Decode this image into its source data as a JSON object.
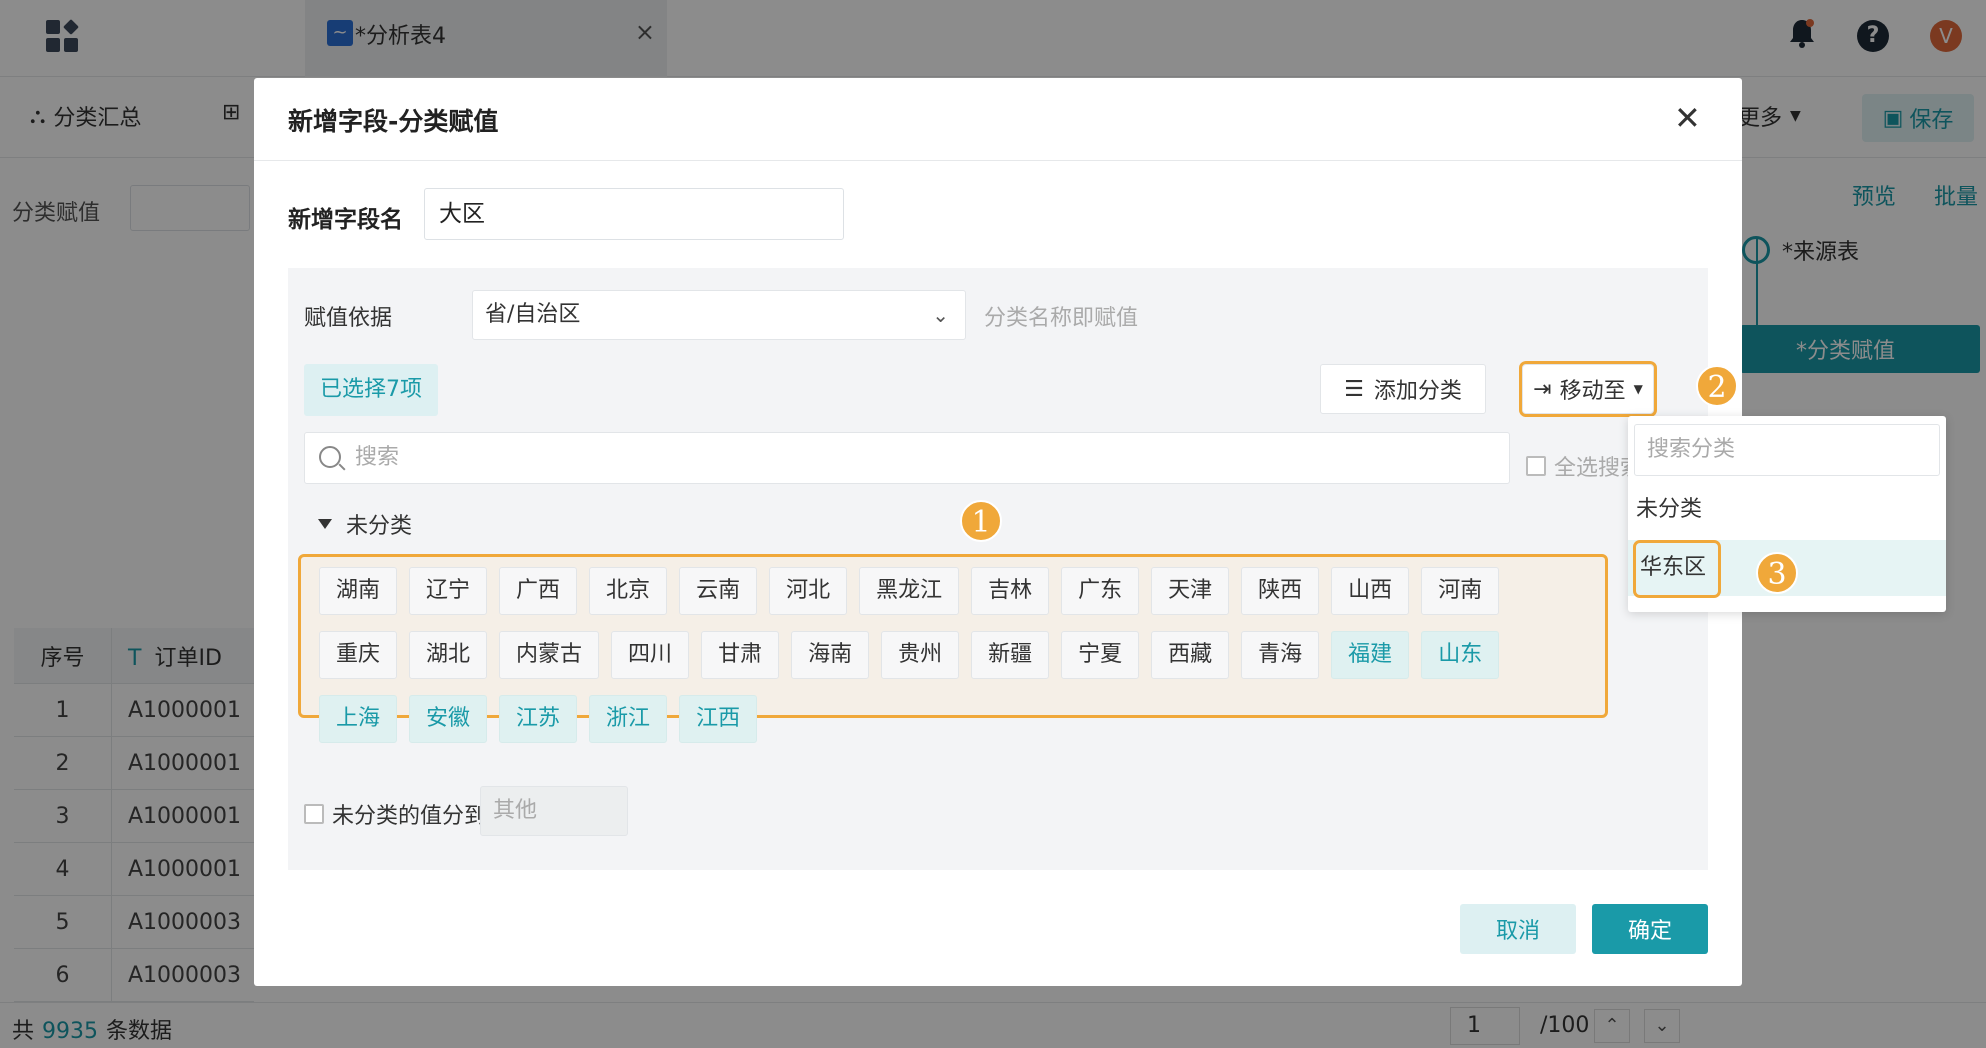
{
  "topbar": {
    "doc_tab_title": "*分析表4",
    "doc_tab_close": "×",
    "help_glyph": "?",
    "user_initial": "V"
  },
  "toolbar": {
    "summary_label": "分类汇总",
    "more_label": "更多",
    "save_label": "保存"
  },
  "left_panel": {
    "assign_label": "分类赋值"
  },
  "table": {
    "columns": [
      "序号",
      "订单ID"
    ],
    "column_type_glyph": "T",
    "rows": [
      [
        "1",
        "A1000001"
      ],
      [
        "2",
        "A1000001"
      ],
      [
        "3",
        "A1000001"
      ],
      [
        "4",
        "A1000001"
      ],
      [
        "5",
        "A1000003"
      ],
      [
        "6",
        "A1000003"
      ]
    ]
  },
  "footer": {
    "total_prefix": "共",
    "total_count": "9935",
    "total_suffix": "条数据",
    "page_value": "1",
    "page_total": "/100"
  },
  "right_panel": {
    "preview_link": "预览",
    "batch_link": "批量",
    "source_node": "*来源表",
    "classify_node": "*分类赋值"
  },
  "dialog": {
    "title": "新增字段-分类赋值",
    "field_name_label": "新增字段名",
    "field_name_value": "大区",
    "basis_label": "赋值依据",
    "basis_value": "省/自治区",
    "basis_hint": "分类名称即赋值",
    "selected_badge": "已选择7项",
    "add_category_label": "添加分类",
    "move_to_label": "移动至",
    "search_placeholder": "搜索",
    "select_all_label": "全选搜索",
    "group_label": "未分类",
    "tags": [
      {
        "label": "湖南",
        "selected": false
      },
      {
        "label": "辽宁",
        "selected": false
      },
      {
        "label": "广西",
        "selected": false
      },
      {
        "label": "北京",
        "selected": false
      },
      {
        "label": "云南",
        "selected": false
      },
      {
        "label": "河北",
        "selected": false
      },
      {
        "label": "黑龙江",
        "selected": false
      },
      {
        "label": "吉林",
        "selected": false
      },
      {
        "label": "广东",
        "selected": false
      },
      {
        "label": "天津",
        "selected": false
      },
      {
        "label": "陕西",
        "selected": false
      },
      {
        "label": "山西",
        "selected": false
      },
      {
        "label": "河南",
        "selected": false
      },
      {
        "label": "重庆",
        "selected": false
      },
      {
        "label": "湖北",
        "selected": false
      },
      {
        "label": "内蒙古",
        "selected": false
      },
      {
        "label": "四川",
        "selected": false
      },
      {
        "label": "甘肃",
        "selected": false
      },
      {
        "label": "海南",
        "selected": false
      },
      {
        "label": "贵州",
        "selected": false
      },
      {
        "label": "新疆",
        "selected": false
      },
      {
        "label": "宁夏",
        "selected": false
      },
      {
        "label": "西藏",
        "selected": false
      },
      {
        "label": "青海",
        "selected": false
      },
      {
        "label": "福建",
        "selected": true
      },
      {
        "label": "山东",
        "selected": true
      },
      {
        "label": "上海",
        "selected": true
      },
      {
        "label": "安徽",
        "selected": true
      },
      {
        "label": "江苏",
        "selected": true
      },
      {
        "label": "浙江",
        "selected": true
      },
      {
        "label": "江西",
        "selected": true
      }
    ],
    "unclassified_label": "未分类的值分到",
    "unclassified_placeholder": "其他",
    "cancel_label": "取消",
    "ok_label": "确定"
  },
  "dropdown": {
    "search_placeholder": "搜索分类",
    "items": [
      "未分类",
      "华东区"
    ],
    "active_item": "华东区"
  },
  "steps": [
    "1",
    "2",
    "3"
  ],
  "colors": {
    "accent": "#1a9aa8",
    "highlight": "#f0a83a"
  }
}
